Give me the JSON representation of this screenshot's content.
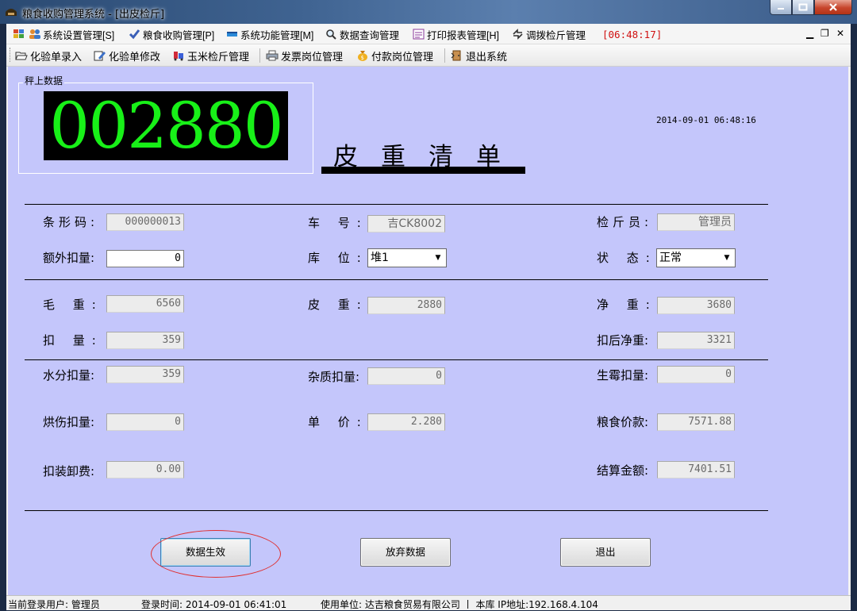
{
  "window": {
    "title": "粮食收购管理系统 - [出皮检斤]"
  },
  "menu": {
    "items": [
      {
        "label": "系统设置管理[S]"
      },
      {
        "label": "粮食收购管理[P]"
      },
      {
        "label": "系统功能管理[M]"
      },
      {
        "label": "数据查询管理"
      },
      {
        "label": "打印报表管理[H]"
      },
      {
        "label": "调拨检斤管理"
      }
    ],
    "clock": "[06:48:17]"
  },
  "toolbar": {
    "items": [
      {
        "label": "化验单录入"
      },
      {
        "label": "化验单修改"
      },
      {
        "label": "玉米检斤管理"
      },
      {
        "label": "发票岗位管理"
      },
      {
        "label": "付款岗位管理"
      },
      {
        "label": "退出系统"
      }
    ]
  },
  "weigh": {
    "caption": "秤上数据",
    "value": "002880"
  },
  "form": {
    "title": "皮重清单",
    "datetime": "2014-09-01  06:48:16",
    "barcode": {
      "label": "条形码:",
      "value": "000000013"
    },
    "plate": {
      "label": "车  号:",
      "value": "吉CK8002"
    },
    "inspector": {
      "label": "检斤员:",
      "value": "管理员"
    },
    "extra": {
      "label": "额外扣量:",
      "value": "0"
    },
    "storage": {
      "label": "库  位:",
      "value": "堆1"
    },
    "status": {
      "label": "状  态:",
      "value": "正常"
    },
    "gross": {
      "label": "毛  重:",
      "value": "6560"
    },
    "tare": {
      "label": "皮  重:",
      "value": "2880"
    },
    "net": {
      "label": "净  重:",
      "value": "3680"
    },
    "deduct": {
      "label": "扣  量:",
      "value": "359"
    },
    "net_after": {
      "label": "扣后净重:",
      "value": "3321"
    },
    "moisture": {
      "label": "水分扣量:",
      "value": "359"
    },
    "impurity": {
      "label": "杂质扣量:",
      "value": "0"
    },
    "mildew": {
      "label": "生霉扣量:",
      "value": "0"
    },
    "heat": {
      "label": "烘伤扣量:",
      "value": "0"
    },
    "price": {
      "label": "单  价:",
      "value": "2.280"
    },
    "grain_pay": {
      "label": "粮食价款:",
      "value": "7571.88"
    },
    "loading": {
      "label": "扣装卸费:",
      "value": "0.00"
    },
    "settle": {
      "label": "结算金额:",
      "value": "7401.51"
    }
  },
  "buttons": {
    "apply": "数据生效",
    "discard": "放弃数据",
    "exit": "退出"
  },
  "status": {
    "user": "当前登录用户:  管理员",
    "login": "登录时间:  2014-09-01 06:41:01",
    "org": "使用单位:  达吉粮食贸易有限公司 丨 本库  IP地址:192.168.4.104"
  }
}
